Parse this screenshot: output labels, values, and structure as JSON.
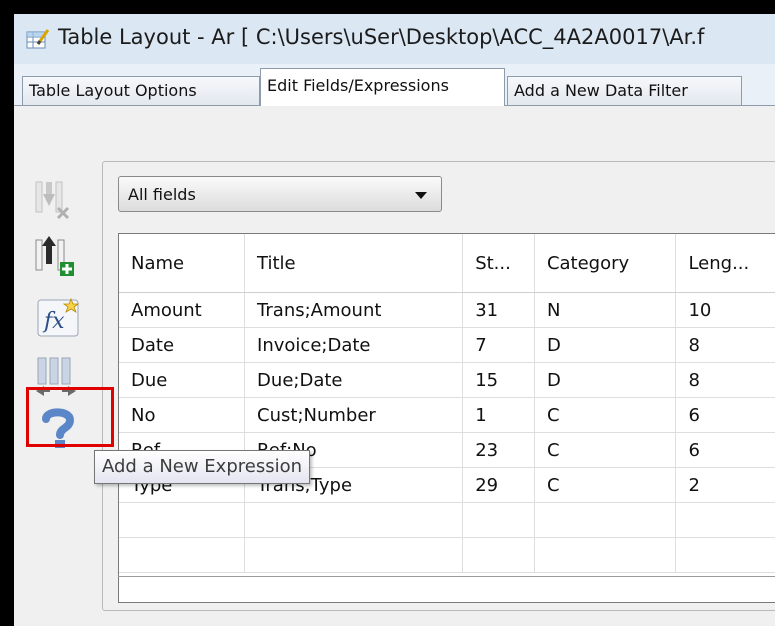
{
  "window": {
    "title": "Table Layout - Ar [ C:\\Users\\uSer\\Desktop\\ACC_4A2A0017\\Ar.f"
  },
  "tabs": [
    {
      "label": "Table Layout Options",
      "active": false
    },
    {
      "label": "Edit Fields/Expressions",
      "active": true
    },
    {
      "label": "Add a New Data Filter",
      "active": false
    }
  ],
  "toolbar": {
    "buttons": [
      {
        "icon": "remove-field-icon",
        "enabled": false
      },
      {
        "icon": "add-field-icon",
        "enabled": true
      },
      {
        "icon": "add-expression-icon",
        "enabled": true,
        "highlighted": true
      },
      {
        "icon": "move-column-icon",
        "enabled": false
      },
      {
        "icon": "help-icon",
        "enabled": true
      }
    ],
    "tooltip": "Add a New Expression"
  },
  "filter": {
    "selected": "All fields"
  },
  "grid": {
    "columns": [
      "Name",
      "Title",
      "St...",
      "Category",
      "Leng..."
    ],
    "rows": [
      [
        "Amount",
        "Trans;Amount",
        "31",
        "N",
        "10"
      ],
      [
        "Date",
        "Invoice;Date",
        "7",
        "D",
        "8"
      ],
      [
        "Due",
        "Due;Date",
        "15",
        "D",
        "8"
      ],
      [
        "No",
        "Cust;Number",
        "1",
        "C",
        "6"
      ],
      [
        "Ref",
        "Ref;No",
        "23",
        "C",
        "6"
      ],
      [
        "Type",
        "Trans;Type",
        "29",
        "C",
        "2"
      ],
      [
        "",
        "",
        "",
        "",
        ""
      ],
      [
        "",
        "",
        "",
        "",
        ""
      ]
    ]
  },
  "colors": {
    "highlight_border": "#e00000",
    "titlebar": "#dbe7f3",
    "panel": "#f0f0f0"
  }
}
